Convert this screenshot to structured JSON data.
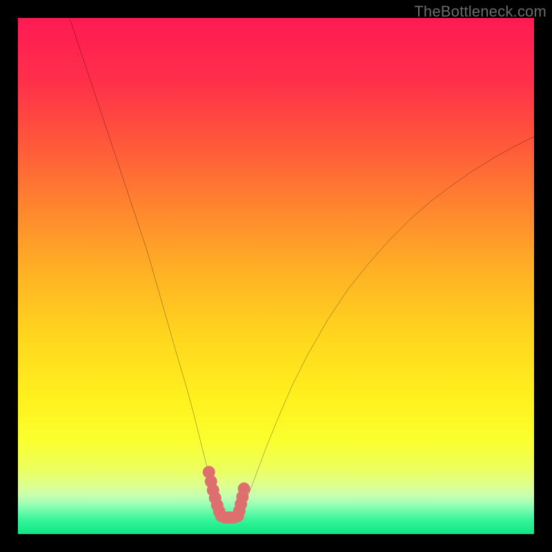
{
  "watermark": "TheBottleneck.com",
  "chart_data": {
    "type": "line",
    "title": "",
    "xlabel": "",
    "ylabel": "",
    "xlim": [
      0,
      100
    ],
    "ylim": [
      0,
      100
    ],
    "grid": false,
    "series": [
      {
        "name": "bottleneck-curve",
        "color": "#000000",
        "x": [
          10,
          13,
          16,
          19,
          22,
          25,
          27,
          29,
          31,
          32.5,
          34,
          35,
          36,
          37,
          37.8,
          38.5,
          39,
          39.4,
          40,
          41,
          42,
          42.6,
          43.2,
          44,
          45,
          46.5,
          48,
          50,
          53,
          56,
          60,
          64,
          68,
          72,
          76,
          80,
          84,
          88,
          92,
          96,
          100
        ],
        "y": [
          100,
          91,
          82,
          73,
          64,
          55,
          48,
          41,
          34,
          29,
          23.5,
          19.5,
          15.5,
          11.5,
          8.5,
          6,
          4.3,
          3.5,
          3.2,
          3.2,
          3.2,
          3.5,
          4.2,
          6,
          8.5,
          12.5,
          16.5,
          21.5,
          28.5,
          34.5,
          41.5,
          47.5,
          52.5,
          57,
          61,
          64.5,
          67.5,
          70.3,
          72.8,
          75,
          77
        ]
      },
      {
        "name": "marker-dots",
        "type": "scatter",
        "color": "#de6f6f",
        "x": [
          37.0,
          37.4,
          37.8,
          38.2,
          38.6,
          39.0,
          39.4,
          40.2,
          41.0,
          41.8,
          42.6,
          42.9,
          43.2,
          43.5,
          43.8
        ],
        "y": [
          12.0,
          10.2,
          8.5,
          7.0,
          5.6,
          4.4,
          3.5,
          3.2,
          3.2,
          3.2,
          3.5,
          4.5,
          5.8,
          7.2,
          8.8
        ]
      }
    ],
    "background_gradient": {
      "stops": [
        {
          "offset": 0.0,
          "color": "#ff1a53"
        },
        {
          "offset": 0.12,
          "color": "#ff2f4a"
        },
        {
          "offset": 0.25,
          "color": "#ff5a3a"
        },
        {
          "offset": 0.38,
          "color": "#ff8a2e"
        },
        {
          "offset": 0.5,
          "color": "#ffb424"
        },
        {
          "offset": 0.62,
          "color": "#ffd71e"
        },
        {
          "offset": 0.74,
          "color": "#fff11e"
        },
        {
          "offset": 0.82,
          "color": "#faff2e"
        },
        {
          "offset": 0.875,
          "color": "#ecff60"
        },
        {
          "offset": 0.905,
          "color": "#dfff8f"
        },
        {
          "offset": 0.925,
          "color": "#c8ffb0"
        },
        {
          "offset": 0.94,
          "color": "#a0ffb4"
        },
        {
          "offset": 0.955,
          "color": "#6efcab"
        },
        {
          "offset": 0.972,
          "color": "#38f49a"
        },
        {
          "offset": 1.0,
          "color": "#0ce784"
        }
      ]
    }
  }
}
